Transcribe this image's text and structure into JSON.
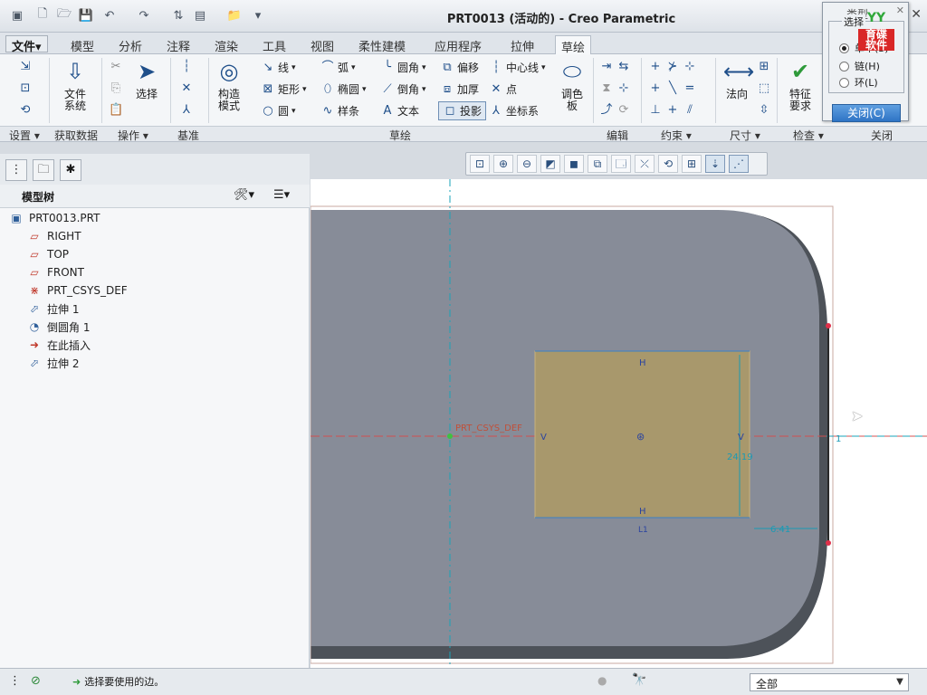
{
  "window": {
    "title": "PRT0013 (活动的) - Creo Parametric",
    "controls": [
      "–",
      "□",
      "✕"
    ]
  },
  "file_menu": "文件▾",
  "tabs": [
    "模型",
    "分析",
    "注释",
    "渲染",
    "工具",
    "视图",
    "柔性建模",
    "应用程序",
    "拉伸",
    "草绘"
  ],
  "ribbon": {
    "file_system": "文件\n系统",
    "select": "选择",
    "construction_mode": "构造\n模式",
    "line": "线",
    "rectangle": "矩形",
    "circle": "圆",
    "arc": "弧",
    "ellipse": "椭圆",
    "spline": "样条",
    "fillet": "圆角",
    "chamfer": "倒角",
    "text": "文本",
    "offset": "偏移",
    "thicken": "加厚",
    "project": "投影",
    "centerline": "中心线",
    "point": "点",
    "coordinate_system": "坐标系",
    "palette": "调色\n板",
    "normal": "法向",
    "feature_requirements": "特征\n要求"
  },
  "groups": [
    "设置",
    "获取数据",
    "操作",
    "基准",
    "草绘",
    "编辑",
    "约束",
    "尺寸",
    "检查",
    "关闭"
  ],
  "group_arrows": [
    "▾",
    "",
    "▾",
    "",
    "",
    "",
    "▾",
    "▾",
    "▾",
    ""
  ],
  "dialog": {
    "title": "类型",
    "section_label": "选择",
    "options": [
      "单个(S)",
      "链(H)",
      "环(L)"
    ],
    "selected": 0,
    "close": "关闭(C)"
  },
  "logo": {
    "top": "YY",
    "bottom": "育碟\n软件"
  },
  "model_tree": {
    "title": "模型树",
    "items": [
      {
        "label": "PRT0013.PRT",
        "icon": "part-icon"
      },
      {
        "label": "RIGHT",
        "icon": "datum-plane-icon"
      },
      {
        "label": "TOP",
        "icon": "datum-plane-icon"
      },
      {
        "label": "FRONT",
        "icon": "datum-plane-icon"
      },
      {
        "label": "PRT_CSYS_DEF",
        "icon": "csys-icon"
      },
      {
        "label": "拉伸 1",
        "icon": "extrude-icon"
      },
      {
        "label": "倒圆角 1",
        "icon": "round-icon"
      },
      {
        "label": "在此插入",
        "icon": "insert-here-icon"
      },
      {
        "label": "拉伸 2",
        "icon": "extrude-icon"
      }
    ]
  },
  "sketch": {
    "csys_label": "PRT_CSYS_DEF",
    "dim_height": "24.19",
    "dim_offset": "6.41",
    "constraint_h": "H",
    "constraint_v": "V",
    "constraint_l": "L1",
    "axis_label": "1"
  },
  "status": {
    "message": "选择要使用的边。",
    "filter": "全部"
  },
  "colors": {
    "part_face": "#878c98",
    "sketch_fill": "#a8986c",
    "accent": "#2f74c5"
  }
}
